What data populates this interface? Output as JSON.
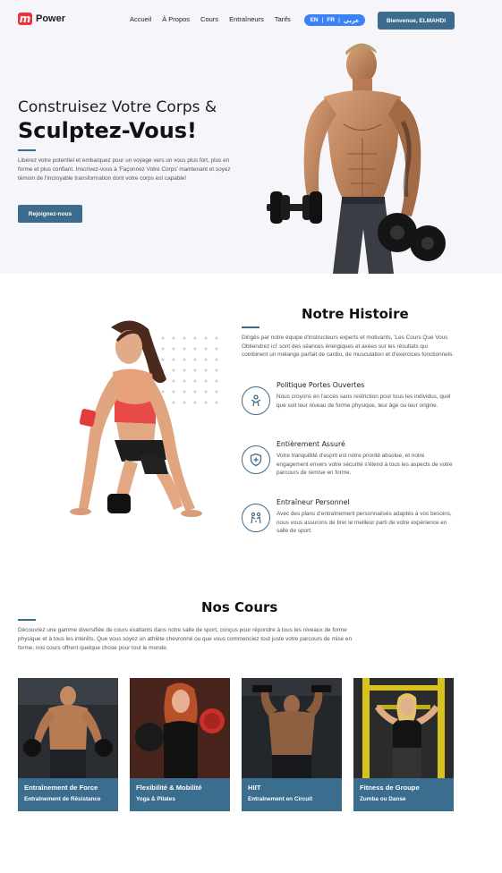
{
  "brand": {
    "name": "Power",
    "logo_letter": "m"
  },
  "nav": {
    "links": [
      "Accueil",
      "À Propos",
      "Cours",
      "Entraîneurs",
      "Tarifs"
    ],
    "lang": [
      "EN",
      "FR",
      "عربي"
    ],
    "welcome": "Bienvenue, ELMAHDI"
  },
  "hero": {
    "title_line1": "Construisez Votre Corps &",
    "title_line2": "Sculptez-Vous!",
    "text": "Libérez votre potentiel et embarquez pour un voyage vers un vous plus fort, plus en forme et plus confiant. Inscrivez-vous à 'Façonnez Votre Corps' maintenant et soyez témoin de l'incroyable transformation dont votre corps est capable!",
    "cta": "Rejoignez-nous"
  },
  "history": {
    "title": "Notre Histoire",
    "intro": "Dirigés par notre équipe d'instructeurs experts et motivants, 'Les Cours Que Vous Obtiendrez ici' sont des séances énergiques et axées sur les résultats qui combinent un mélange parfait de cardio, de musculation et d'exercices fonctionnels.",
    "features": [
      {
        "title": "Politique Portes Ouvertes",
        "text": "Nous croyons en l'accès sans restriction pour tous les individus, quel que soit leur niveau de forme physique, leur âge ou leur origine.",
        "icon": "people-icon"
      },
      {
        "title": "Entièrement Assuré",
        "text": "Votre tranquillité d'esprit est notre priorité absolue, et notre engagement envers votre sécurité s'étend à tous les aspects de votre parcours de remise en forme.",
        "icon": "shield-plus-icon"
      },
      {
        "title": "Entraîneur Personnel",
        "text": "Avec des plans d'entraînement personnalisés adaptés à vos besoins, nous vous assurons de tirer le meilleur parti de votre expérience en salle de sport.",
        "icon": "trainer-icon"
      }
    ]
  },
  "courses": {
    "title": "Nos Cours",
    "text": "Découvrez une gamme diversifiée de cours exaltants dans notre salle de sport, conçus pour répondre à tous les niveaux de forme physique et à tous les intérêts. Que vous soyez un athlète chevronné ou que vous commenciez tout juste votre parcours de mise en forme, nos cours offrent quelque chose pour tout le monde.",
    "cards": [
      {
        "title": "Entraînement de Force",
        "subtitle": "Entraînement de Résistance"
      },
      {
        "title": "Flexibilité & Mobilité",
        "subtitle": "Yoga & Pilates"
      },
      {
        "title": "HIIT",
        "subtitle": "Entraînement en Circuit"
      },
      {
        "title": "Fitness de Groupe",
        "subtitle": "Zumba ou Danse"
      }
    ]
  },
  "colors": {
    "accent": "#3d6b8c",
    "brand": "#e8343b",
    "lang_pill": "#3b82f6",
    "hero_bg": "#f5f5fa"
  }
}
